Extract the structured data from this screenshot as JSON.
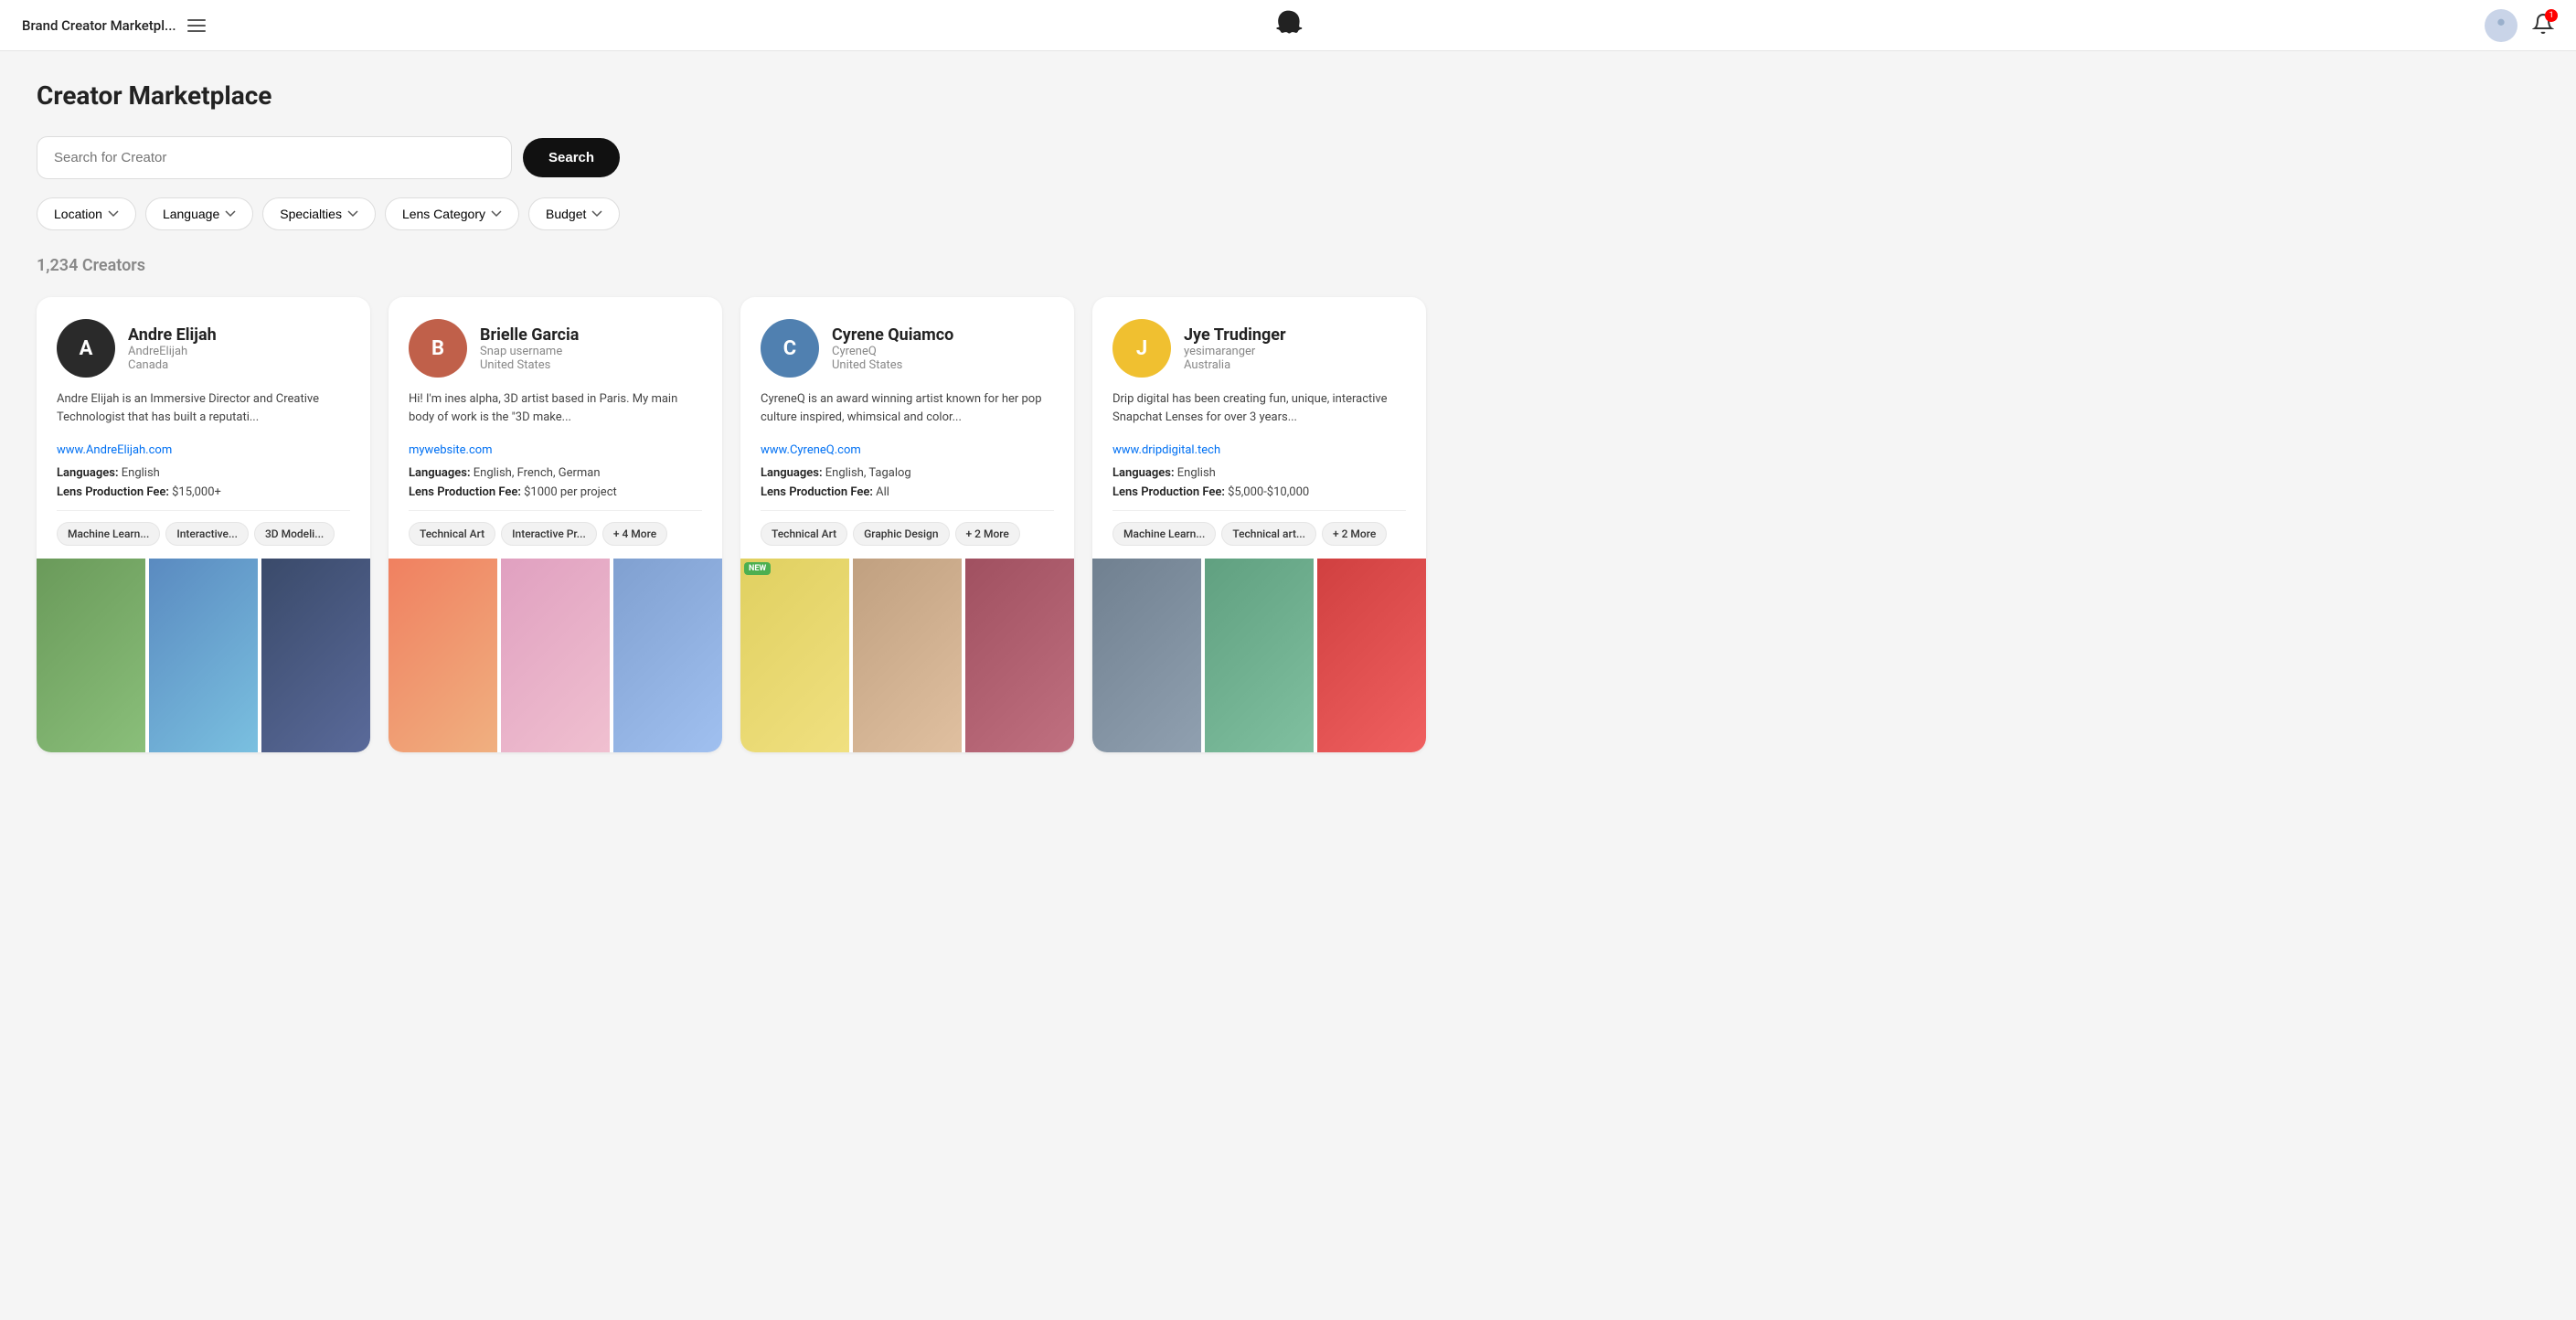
{
  "nav": {
    "title": "Brand Creator Marketpl...",
    "notification_count": "1"
  },
  "page": {
    "title": "Creator Marketplace",
    "search_placeholder": "Search for Creator",
    "search_button": "Search",
    "results_count": "1,234 Creators"
  },
  "filters": [
    {
      "label": "Location"
    },
    {
      "label": "Language"
    },
    {
      "label": "Specialties"
    },
    {
      "label": "Lens Category"
    },
    {
      "label": "Budget"
    }
  ],
  "creators": [
    {
      "name": "Andre Elijah",
      "username": "AndreElijah",
      "country": "Canada",
      "bio": "Andre Elijah is an Immersive Director and Creative Technologist that has built a reputati...",
      "link": "www.AndreElijah.com",
      "languages": "English",
      "fee": "$15,000+",
      "tags": [
        "Machine Learn...",
        "Interactive...",
        "3D Modeli..."
      ],
      "av_color": "av-dark",
      "av_letter": "A",
      "thumbs": [
        "t1",
        "t2",
        "t3"
      ]
    },
    {
      "name": "Brielle Garcia",
      "username": "Snap username",
      "country": "United States",
      "bio": "Hi! I'm ines alpha, 3D artist based in Paris. My main body of work is the \"3D make...",
      "link": "mywebsite.com",
      "languages": "English, French, German",
      "fee": "$1000 per project",
      "tags": [
        "Technical Art",
        "Interactive Pr...",
        "+ 4 More"
      ],
      "av_color": "av-orange",
      "av_letter": "B",
      "thumbs": [
        "t4",
        "t5",
        "t6"
      ]
    },
    {
      "name": "Cyrene Quiamco",
      "username": "CyreneQ",
      "country": "United States",
      "bio": "CyreneQ is an award winning artist known for her pop culture inspired, whimsical and color...",
      "link": "www.CyreneQ.com",
      "languages": "English, Tagalog",
      "fee": "All",
      "tags": [
        "Technical Art",
        "Graphic Design",
        "+ 2 More"
      ],
      "av_color": "av-blue",
      "av_letter": "C",
      "thumbs": [
        "t7",
        "t8",
        "t9"
      ],
      "thumb_badge": 0
    },
    {
      "name": "Jye Trudinger",
      "username": "yesimaranger",
      "country": "Australia",
      "bio": "Drip digital has been creating fun, unique, interactive Snapchat Lenses for over 3 years...",
      "link": "www.dripdigital.tech",
      "languages": "English",
      "fee": "$5,000-$10,000",
      "tags": [
        "Machine Learn...",
        "Technical art...",
        "+ 2 More"
      ],
      "av_color": "av-yellow",
      "av_letter": "J",
      "thumbs": [
        "t10",
        "t11",
        "t12"
      ]
    }
  ]
}
